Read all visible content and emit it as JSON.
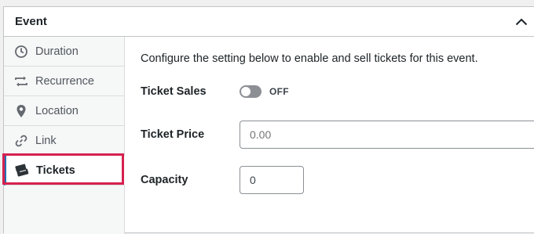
{
  "panel": {
    "title": "Event"
  },
  "tabs": [
    {
      "label": "Duration",
      "icon": "clock-icon"
    },
    {
      "label": "Recurrence",
      "icon": "repeat-icon"
    },
    {
      "label": "Location",
      "icon": "map-pin-icon"
    },
    {
      "label": "Link",
      "icon": "link-icon"
    },
    {
      "label": "Tickets",
      "icon": "tickets-icon",
      "active": true
    }
  ],
  "tickets": {
    "intro": "Configure the setting below to enable and sell tickets for this event.",
    "sales_label": "Ticket Sales",
    "sales_state": "OFF",
    "price_label": "Ticket Price",
    "price_placeholder": "0.00",
    "capacity_label": "Capacity",
    "capacity_value": "0"
  },
  "colors": {
    "accent": "#2271b1",
    "highlight": "#d6214f"
  }
}
